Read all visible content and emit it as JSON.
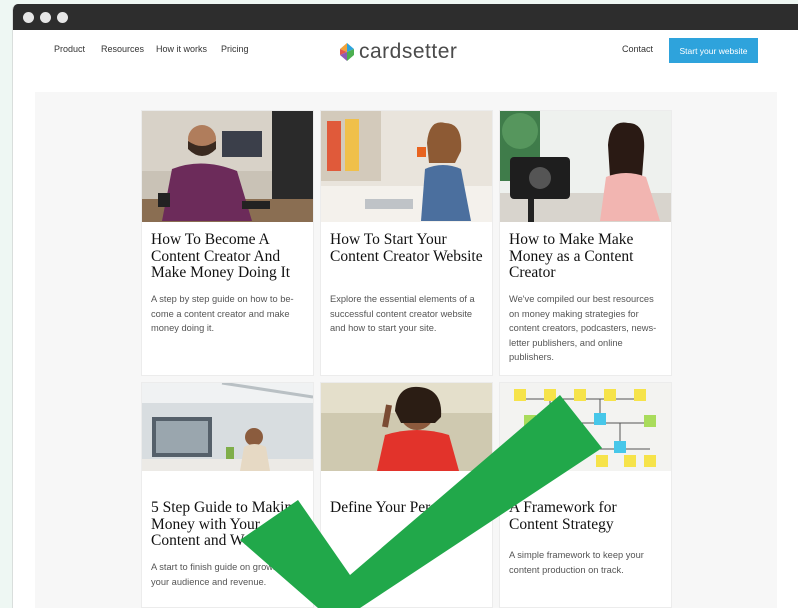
{
  "nav": {
    "links": [
      "Product",
      "Resources",
      "How it works",
      "Pricing"
    ],
    "logo_text": "cardsetter",
    "contact": "Contact",
    "cta": "Start your website"
  },
  "cards": [
    {
      "title": "How To Become A Content Creator And Make Money Doing It",
      "desc": [
        "A step by step guide on how to be-",
        "come a content creator and make",
        "money doing it."
      ]
    },
    {
      "title": "How To Start Your Content Creator Website",
      "desc": [
        "Explore the essential elements of a",
        "successful content creator website",
        "and how to start your site."
      ]
    },
    {
      "title": "How to Make Make Money as a Content Creator",
      "desc": [
        "We've compiled our best resources",
        "on money making strategies for",
        "content creators, podcasters, news-",
        "letter publishers, and online",
        "publishers."
      ]
    },
    {
      "title": "5 Step Guide to Making Money with Your Content and Website",
      "desc": [
        "A start to finish guide on growing",
        "your audience and revenue."
      ]
    },
    {
      "title": "Define Your Persona",
      "desc": [
        "",
        ""
      ]
    },
    {
      "title": "A Framework for Content Strategy",
      "desc": [
        "A simple framework to keep your",
        "content production on track."
      ]
    }
  ],
  "colors": {
    "accent": "#2ea3dc",
    "checkmark": "#21a84a",
    "titlebar": "#2d2d2d"
  }
}
